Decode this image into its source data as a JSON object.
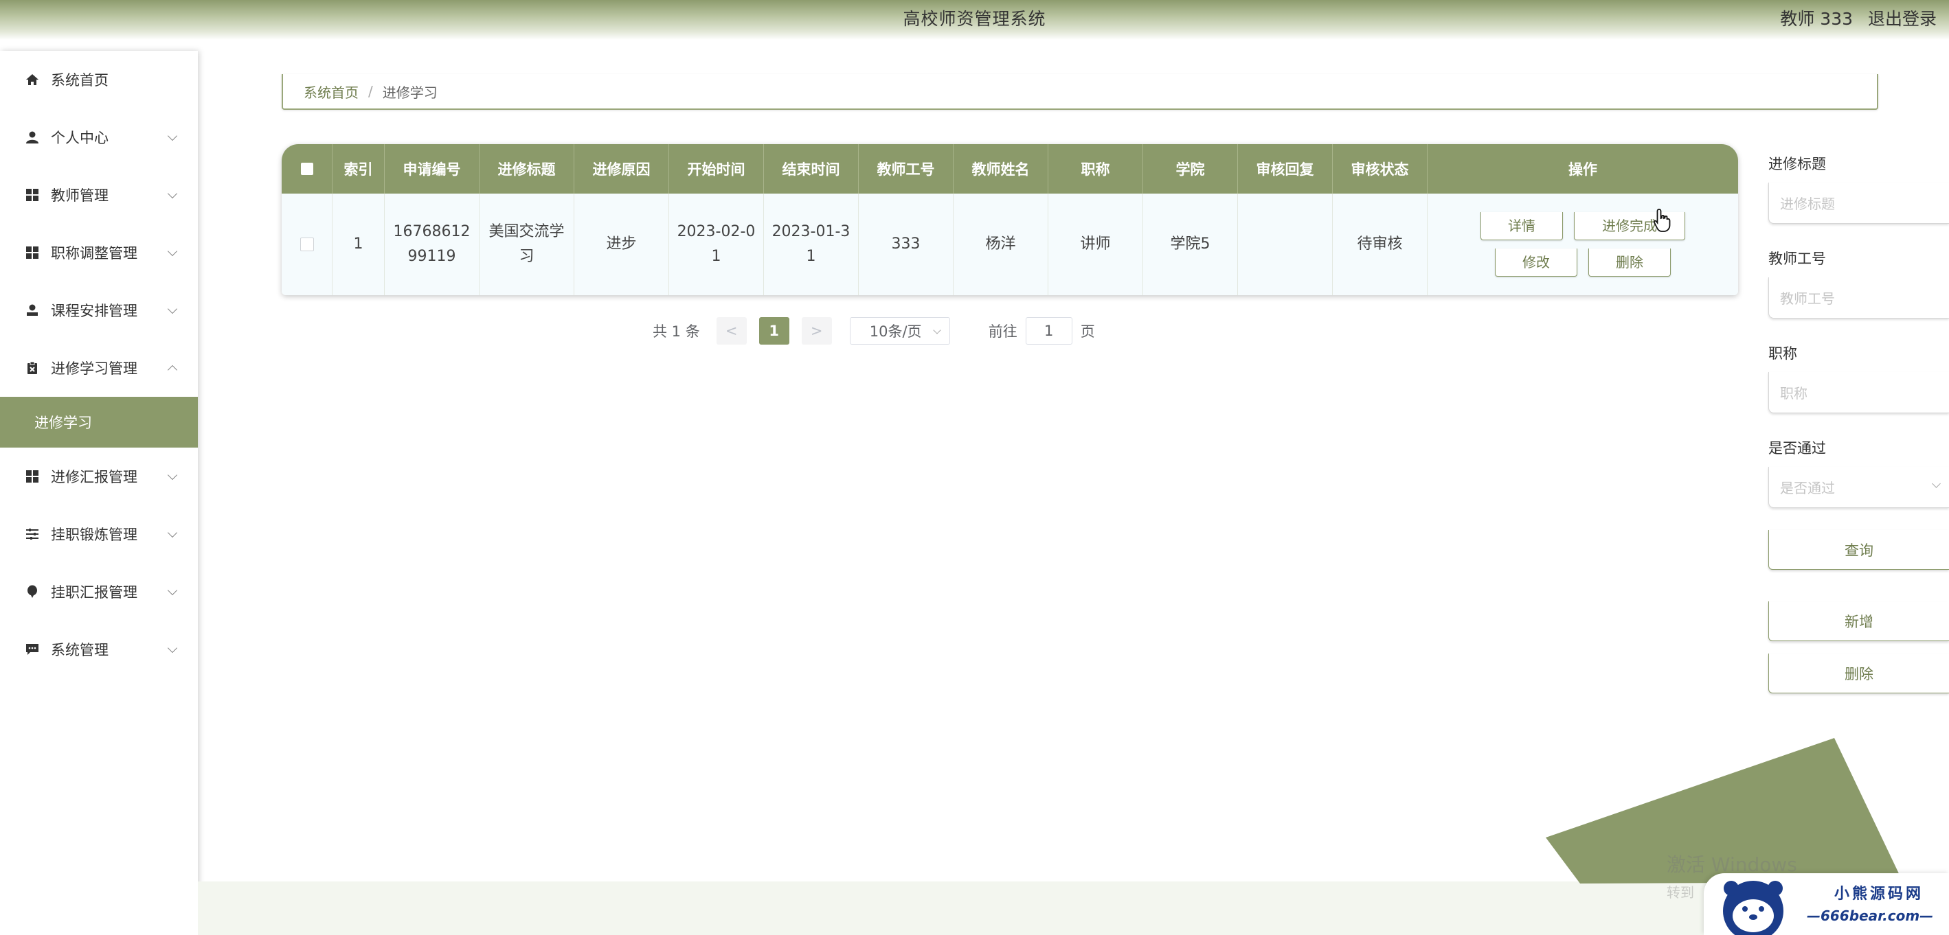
{
  "header": {
    "title": "高校师资管理系统",
    "user": "教师 333",
    "logout": "退出登录"
  },
  "sidebar": {
    "items": [
      {
        "label": "系统首页",
        "icon": "home-icon",
        "expandable": false
      },
      {
        "label": "个人中心",
        "icon": "user-icon",
        "expandable": true
      },
      {
        "label": "教师管理",
        "icon": "grid-icon",
        "expandable": true
      },
      {
        "label": "职称调整管理",
        "icon": "grid-icon",
        "expandable": true
      },
      {
        "label": "课程安排管理",
        "icon": "user-stamp-icon",
        "expandable": true
      },
      {
        "label": "进修学习管理",
        "icon": "clipboard-icon",
        "expandable": true,
        "expanded": true
      },
      {
        "label": "进修汇报管理",
        "icon": "grid-icon",
        "expandable": true
      },
      {
        "label": "挂职锻炼管理",
        "icon": "sliders-icon",
        "expandable": true
      },
      {
        "label": "挂职汇报管理",
        "icon": "balloon-icon",
        "expandable": true
      },
      {
        "label": "系统管理",
        "icon": "chat-icon",
        "expandable": true
      }
    ],
    "active_sub": "进修学习"
  },
  "breadcrumb": {
    "home": "系统首页",
    "separator": "/",
    "current": "进修学习"
  },
  "table": {
    "headers": [
      "索引",
      "申请编号",
      "进修标题",
      "进修原因",
      "开始时间",
      "结束时间",
      "教师工号",
      "教师姓名",
      "职称",
      "学院",
      "审核回复",
      "审核状态",
      "操作"
    ],
    "rows": [
      {
        "index": "1",
        "app_no": "1676861299119",
        "title": "美国交流学习",
        "reason": "进步",
        "start": "2023-02-01",
        "end": "2023-01-31",
        "teacher_no": "333",
        "teacher_name": "杨洋",
        "job_title": "讲师",
        "college": "学院5",
        "reply": "",
        "status": "待审核"
      }
    ],
    "actions": {
      "detail": "详情",
      "complete": "进修完成",
      "edit": "修改",
      "delete": "删除"
    }
  },
  "pagination": {
    "total": "共 1 条",
    "prev": "<",
    "current_page": "1",
    "next": ">",
    "page_size": "10条/页",
    "goto_prefix": "前往",
    "goto_value": "1",
    "goto_suffix": "页"
  },
  "filters": {
    "title_label": "进修标题",
    "title_placeholder": "进修标题",
    "teacher_no_label": "教师工号",
    "teacher_no_placeholder": "教师工号",
    "job_title_label": "职称",
    "job_title_placeholder": "职称",
    "passed_label": "是否通过",
    "passed_placeholder": "是否通过",
    "search_button": "查询",
    "add_button": "新增",
    "delete_button": "删除"
  },
  "watermark": {
    "line1": "激活 Windows",
    "line2": "转到"
  },
  "logo": {
    "line1": "小熊源码网",
    "line2": "—666bear.com—"
  },
  "colors": {
    "accent": "#8b9a6a",
    "accent_dark": "#6f7d4e",
    "row_bg": "#f5fbfd"
  }
}
